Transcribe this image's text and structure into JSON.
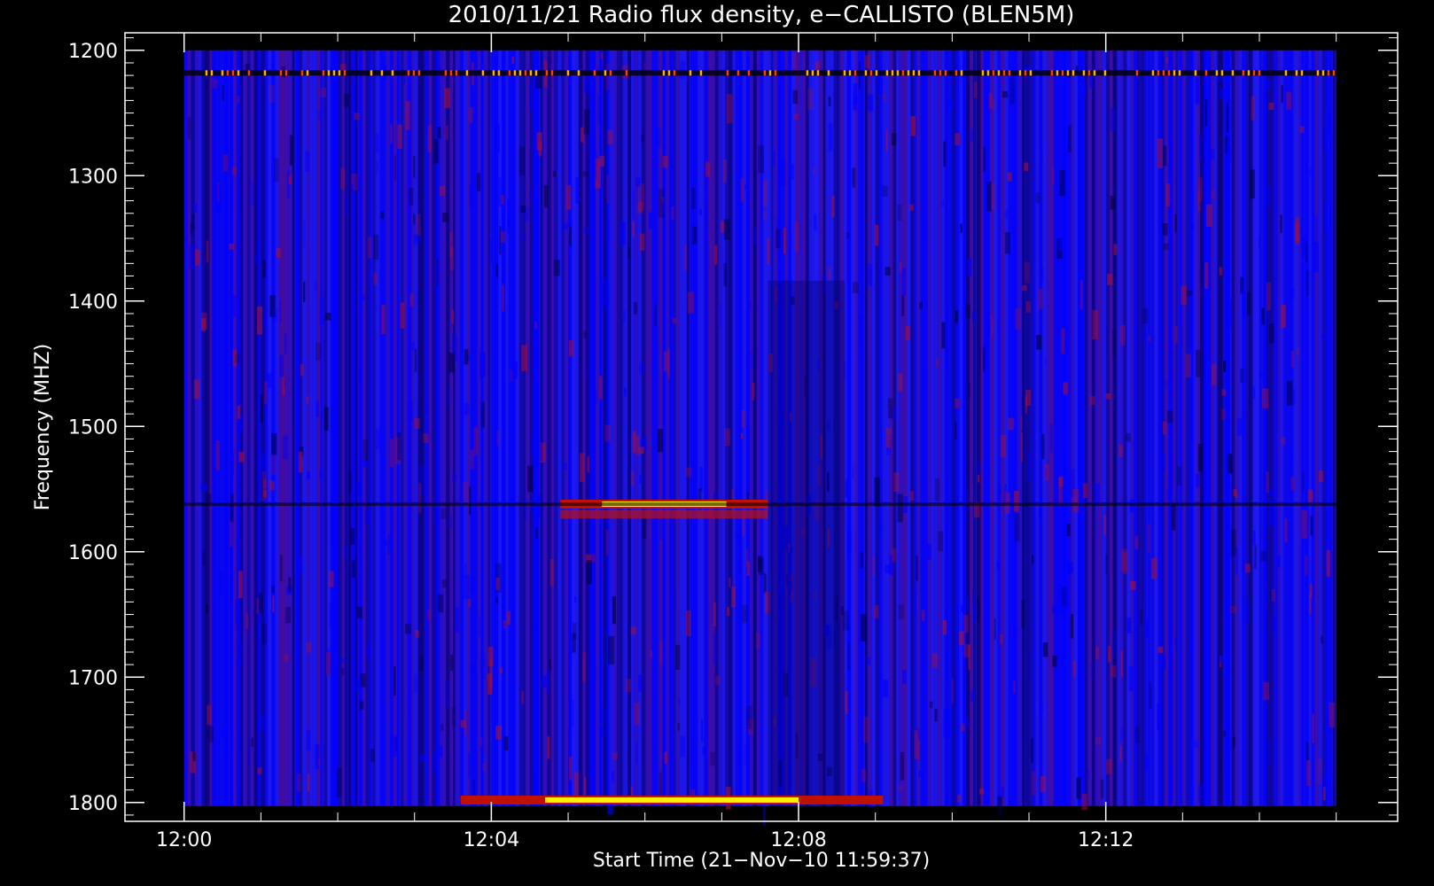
{
  "chart_data": {
    "type": "heatmap",
    "title": "2010/11/21  Radio flux density, e−CALLISTO (BLEN5M)",
    "xlabel": "Start Time (21−Nov−10 11:59:37)",
    "ylabel": "Frequency (MHZ)",
    "x_ticks": [
      "12:00",
      "12:04",
      "12:08",
      "12:12"
    ],
    "x_tick_values_min": [
      0,
      4,
      8,
      12
    ],
    "x_range_min": [
      -0.77,
      15.8
    ],
    "data_extent_min": [
      0,
      15.0
    ],
    "y_ticks": [
      "1200",
      "1300",
      "1400",
      "1500",
      "1600",
      "1700",
      "1800"
    ],
    "y_tick_values": [
      1200,
      1300,
      1400,
      1500,
      1600,
      1700,
      1800
    ],
    "y_range": [
      1186,
      1815
    ],
    "y_inverted": true,
    "colormap": [
      "#000000",
      "#0000ff",
      "#b00020",
      "#ff4000",
      "#ffff00"
    ],
    "features": [
      {
        "freq_mhz": 1218,
        "t_start_min": 0,
        "t_end_min": 15.0,
        "intensity": "high",
        "pattern": "dashed"
      },
      {
        "freq_mhz": 1562,
        "t_start_min": 4.9,
        "t_end_min": 7.6,
        "intensity": "peak"
      },
      {
        "freq_mhz": 1570,
        "t_start_min": 4.9,
        "t_end_min": 7.6,
        "intensity": "medium"
      },
      {
        "freq_mhz": 1798,
        "t_start_min": 3.6,
        "t_end_min": 9.1,
        "intensity": "peak"
      }
    ]
  }
}
